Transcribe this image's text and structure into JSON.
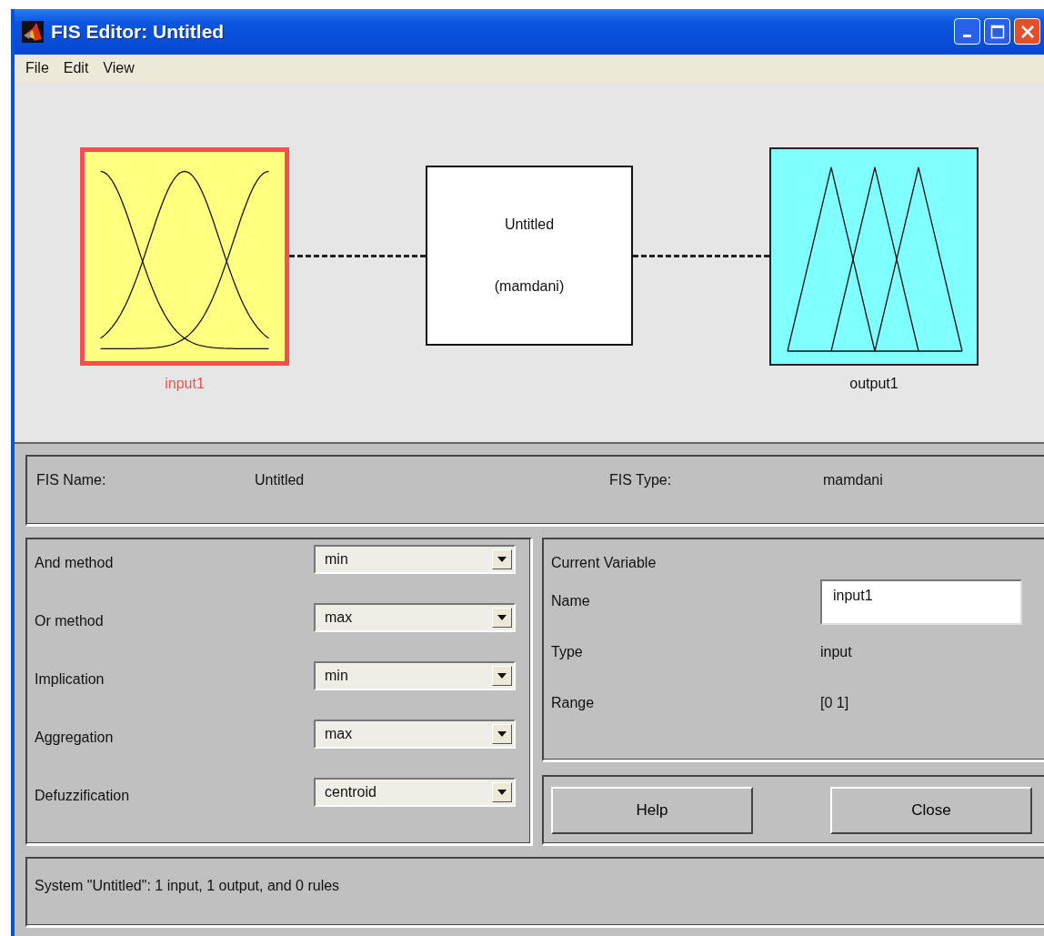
{
  "window": {
    "title": "FIS Editor: Untitled"
  },
  "menu": [
    "File",
    "Edit",
    "View"
  ],
  "diagram": {
    "input": {
      "label": "input1",
      "selected": true
    },
    "system": {
      "name": "Untitled",
      "type": "(mamdani)"
    },
    "output": {
      "label": "output1",
      "selected": false
    }
  },
  "fis_info": {
    "name_label": "FIS Name:",
    "name": "Untitled",
    "type_label": "FIS Type:",
    "type": "mamdani"
  },
  "methods": [
    {
      "label": "And method",
      "value": "min"
    },
    {
      "label": "Or method",
      "value": "max"
    },
    {
      "label": "Implication",
      "value": "min"
    },
    {
      "label": "Aggregation",
      "value": "max"
    },
    {
      "label": "Defuzzification",
      "value": "centroid"
    }
  ],
  "current_variable": {
    "title": "Current Variable",
    "name_label": "Name",
    "name": "input1",
    "type_label": "Type",
    "type": "input",
    "range_label": "Range",
    "range": "[0 1]"
  },
  "buttons": [
    "Help",
    "Close"
  ],
  "status": "System \"Untitled\": 1 input, 1 output, and 0 rules"
}
